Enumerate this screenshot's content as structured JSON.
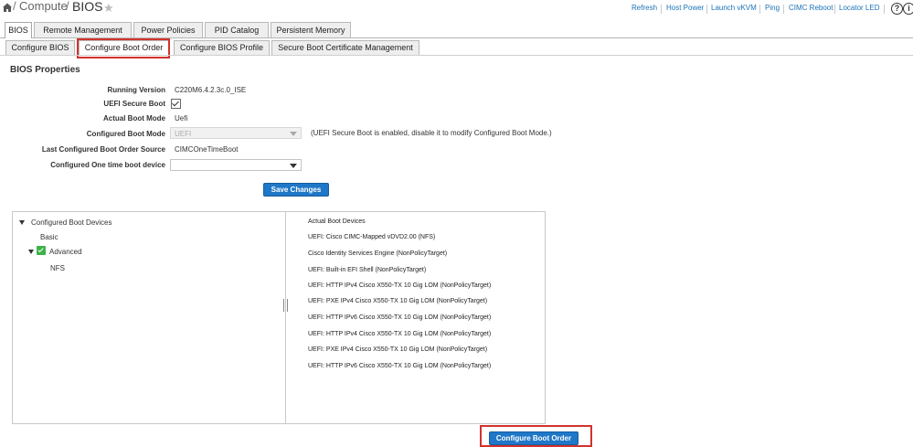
{
  "breadcrumb": {
    "items": [
      "Compute",
      "BIOS"
    ],
    "separator": "/"
  },
  "header_links": [
    "Refresh",
    "Host Power",
    "Launch vKVM",
    "Ping",
    "CIMC Reboot",
    "Locator LED"
  ],
  "icons": {
    "home": "home-icon",
    "favorite": "star-icon",
    "help": "help-icon",
    "info": "info-icon"
  },
  "tabs_primary": [
    "BIOS",
    "Remote Management",
    "Power Policies",
    "PID Catalog",
    "Persistent Memory"
  ],
  "tabs_primary_active": "BIOS",
  "tabs_secondary": [
    "Configure BIOS",
    "Configure Boot Order",
    "Configure BIOS Profile",
    "Secure Boot Certificate Management"
  ],
  "tabs_secondary_active": "Configure Boot Order",
  "section_title": "BIOS Properties",
  "properties": {
    "running_version": {
      "label": "Running Version",
      "value": "C220M6.4.2.3c.0_ISE"
    },
    "uefi_secure_boot": {
      "label": "UEFI Secure Boot",
      "checked": true
    },
    "actual_boot_mode": {
      "label": "Actual Boot Mode",
      "value": "Uefi"
    },
    "configured_boot_mode": {
      "label": "Configured Boot Mode",
      "value": "UEFI",
      "hint": "(UEFI Secure Boot is enabled, disable it to modify Configured Boot Mode.)"
    },
    "last_configured_source": {
      "label": "Last Configured Boot Order Source",
      "value": "CIMCOneTimeBoot"
    },
    "one_time_boot": {
      "label": "Configured One time boot device",
      "value": ""
    }
  },
  "save_button": "Save Changes",
  "configured_tree": {
    "root": "Configured Boot Devices",
    "basic": "Basic",
    "advanced": "Advanced",
    "advanced_children": [
      "NFS"
    ]
  },
  "actual_boot_devices": {
    "header": "Actual Boot Devices",
    "items": [
      "UEFI: Cisco CIMC-Mapped vDVD2.00 (NFS)",
      "Cisco Identity Services Engine (NonPolicyTarget)",
      "UEFI: Built-in EFI Shell (NonPolicyTarget)",
      "UEFI: HTTP IPv4 Cisco X550-TX 10 Gig LOM (NonPolicyTarget)",
      "UEFI: PXE IPv4 Cisco X550-TX 10 Gig LOM (NonPolicyTarget)",
      "UEFI: HTTP IPv6 Cisco X550-TX 10 Gig LOM (NonPolicyTarget)",
      "UEFI: HTTP IPv4 Cisco X550-TX 10 Gig LOM (NonPolicyTarget)",
      "UEFI: PXE IPv4 Cisco X550-TX 10 Gig LOM (NonPolicyTarget)",
      "UEFI: HTTP IPv6 Cisco X550-TX 10 Gig LOM (NonPolicyTarget)"
    ]
  },
  "configure_boot_order_button": "Configure Boot Order",
  "colors": {
    "accent": "#1f77c8",
    "highlight": "#d3322d",
    "link": "#1b73b8",
    "check": "#3db14a"
  }
}
